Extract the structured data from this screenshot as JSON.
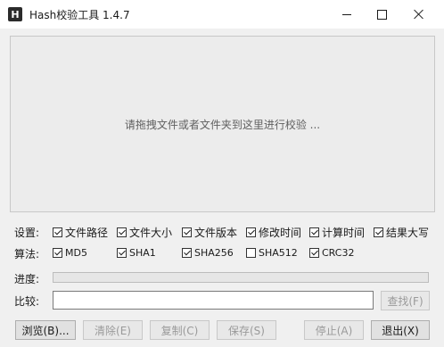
{
  "window": {
    "title": "Hash校验工具 1.4.7",
    "icon_letter": "H"
  },
  "drop_zone": {
    "hint": "请拖拽文件或者文件夹到这里进行校验 ..."
  },
  "settings": {
    "label": "设置:",
    "options": [
      {
        "label": "文件路径",
        "checked": true
      },
      {
        "label": "文件大小",
        "checked": true
      },
      {
        "label": "文件版本",
        "checked": true
      },
      {
        "label": "修改时间",
        "checked": true
      },
      {
        "label": "计算时间",
        "checked": true
      },
      {
        "label": "结果大写",
        "checked": true
      }
    ]
  },
  "algorithms": {
    "label": "算法:",
    "options": [
      {
        "label": "MD5",
        "checked": true
      },
      {
        "label": "SHA1",
        "checked": true
      },
      {
        "label": "SHA256",
        "checked": true
      },
      {
        "label": "SHA512",
        "checked": false
      },
      {
        "label": "CRC32",
        "checked": true
      }
    ]
  },
  "progress": {
    "label": "进度:",
    "value": 0
  },
  "compare": {
    "label": "比较:",
    "value": "",
    "find_button": "查找(F)"
  },
  "buttons": {
    "browse": "浏览(B)...",
    "clear": "清除(E)",
    "copy": "复制(C)",
    "save": "保存(S)",
    "stop": "停止(A)",
    "exit": "退出(X)"
  },
  "icons": {
    "app": "hash-app-icon",
    "minimize": "minimize-icon",
    "maximize": "maximize-icon",
    "close": "close-icon"
  }
}
